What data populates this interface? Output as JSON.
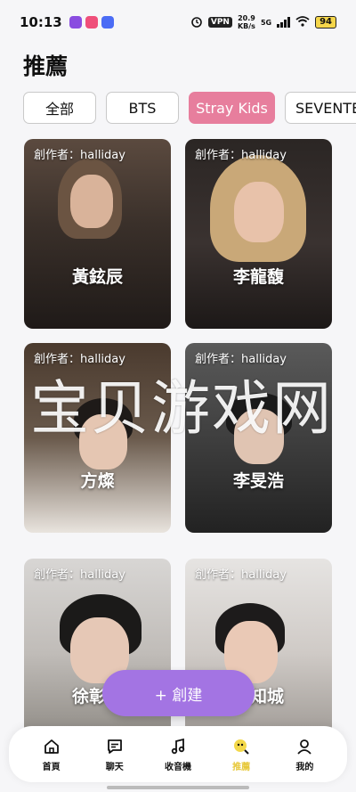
{
  "status_bar": {
    "time": "10:13",
    "vpn": "VPN",
    "net_speed_value": "20.9",
    "net_speed_unit": "KB/s",
    "network": "5G",
    "battery": "94"
  },
  "header": {
    "title": "推薦"
  },
  "tabs": [
    {
      "label": "全部",
      "active": false
    },
    {
      "label": "BTS",
      "active": false
    },
    {
      "label": "Stray Kids",
      "active": true
    },
    {
      "label": "SEVENTE",
      "active": false
    }
  ],
  "cards": [
    {
      "creator": "創作者：halliday",
      "name": "黃鉉辰"
    },
    {
      "creator": "創作者：halliday",
      "name": "李龍馥"
    },
    {
      "creator": "創作者：halliday",
      "name": "方燦"
    },
    {
      "creator": "創作者：halliday",
      "name": "李旻浩"
    },
    {
      "creator": "創作者：halliday",
      "name": "徐彰彬"
    },
    {
      "creator": "創作者：halliday",
      "name": "韓知城"
    }
  ],
  "watermark": "宝贝游戏网",
  "create_button": {
    "label": "+ 創建"
  },
  "bottom_nav": [
    {
      "label": "首頁",
      "icon": "home-icon"
    },
    {
      "label": "聊天",
      "icon": "chat-icon"
    },
    {
      "label": "收音機",
      "icon": "music-icon"
    },
    {
      "label": "推薦",
      "icon": "recommend-icon",
      "active": true
    },
    {
      "label": "我的",
      "icon": "profile-icon"
    }
  ],
  "colors": {
    "accent_pink": "#e77e9d",
    "create_purple": "#a374e3",
    "active_nav_yellow": "#e7c83a"
  }
}
